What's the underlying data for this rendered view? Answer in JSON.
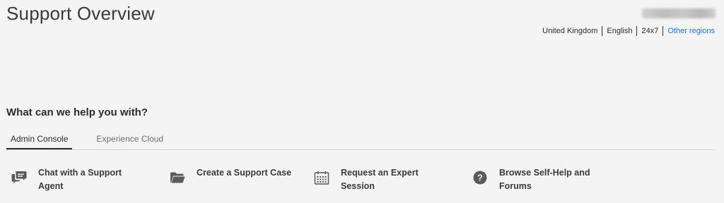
{
  "header": {
    "title": "Support Overview"
  },
  "region_bar": {
    "country": "United Kingdom",
    "language": "English",
    "hours": "24x7",
    "other_regions_link": "Other regions"
  },
  "help": {
    "heading": "What can we help you with?",
    "tabs": [
      {
        "label": "Admin Console",
        "active": true
      },
      {
        "label": "Experience Cloud",
        "active": false
      }
    ],
    "actions": [
      {
        "label": "Chat with a Support Agent",
        "icon": "chat-bubbles-icon"
      },
      {
        "label": "Create a Support Case",
        "icon": "folder-icon"
      },
      {
        "label": "Request an Expert Session",
        "icon": "calendar-icon"
      },
      {
        "label": "Browse Self-Help and Forums",
        "icon": "question-circle-icon"
      }
    ]
  },
  "colors": {
    "background": "#f4f4f4",
    "link": "#1473e6",
    "text": "#2c2c2c",
    "icon": "#5a5a5a"
  }
}
